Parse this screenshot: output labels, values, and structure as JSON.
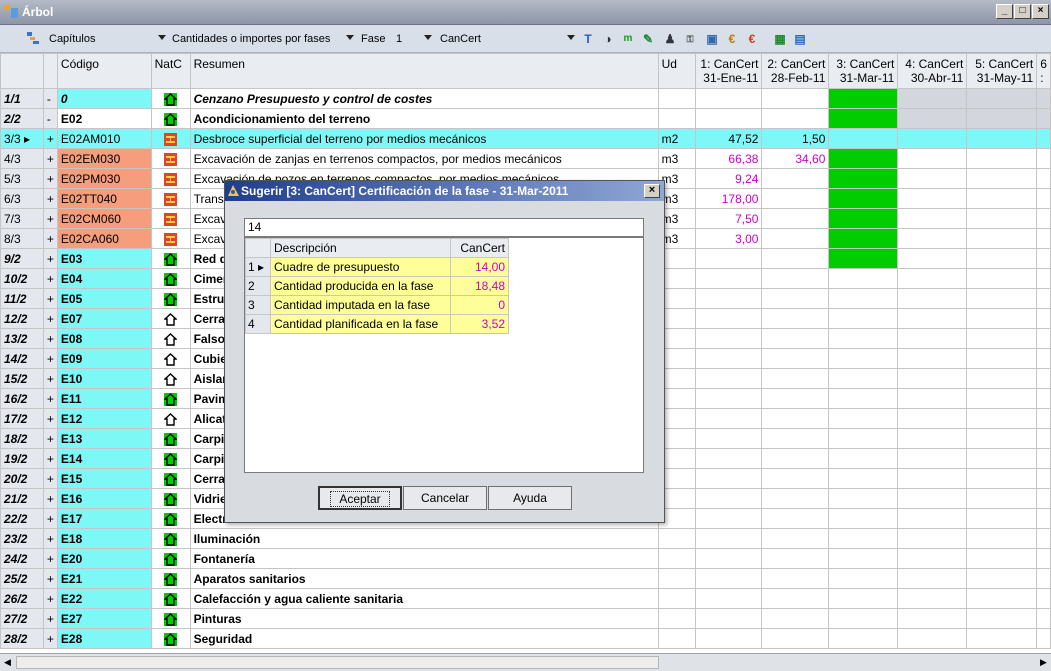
{
  "window": {
    "title": "Árbol",
    "minimize": "_",
    "maximize": "□",
    "close": "×"
  },
  "toolbar": {
    "level_select": "Capítulos",
    "mode_select": "Cantidades o importes por fases",
    "fase_label": "Fase",
    "fase_value": "1",
    "column_select": "CanCert",
    "icons": [
      "text-icon",
      "contrast-icon",
      "measure-icon",
      "edit-icon",
      "people-icon",
      "key-icon",
      "calendar-icon",
      "euro-icon",
      "euro-fill-icon",
      "table-icon",
      "columns-icon"
    ]
  },
  "grid": {
    "headers": {
      "codigo": "Código",
      "natc": "NatC",
      "resumen": "Resumen",
      "ud": "Ud",
      "c1": [
        "1: CanCert",
        "31-Ene-11"
      ],
      "c2": [
        "2: CanCert",
        "28-Feb-11"
      ],
      "c3": [
        "3: CanCert",
        "31-Mar-11"
      ],
      "c4": [
        "4: CanCert",
        "30-Abr-11"
      ],
      "c5": [
        "5: CanCert",
        "31-May-11"
      ],
      "c6": [
        "6",
        ":"
      ]
    },
    "rows": [
      {
        "idx": "1/1",
        "exp": "-",
        "code": "0",
        "nat": "chapter",
        "res": "Cenzano Presupuesto y control de costes",
        "ud": "",
        "v1": "",
        "v2": "",
        "codeStyle": "cyan",
        "resStyle": "bold-italic",
        "idxStyle": "italic"
      },
      {
        "idx": "2/2",
        "exp": "-",
        "code": "E02",
        "nat": "chapter",
        "res": "Acondicionamiento del terreno",
        "ud": "",
        "v1": "",
        "v2": "",
        "codeStyle": "plain",
        "resStyle": "bold",
        "idxStyle": "italic"
      },
      {
        "idx": "3/3 ▸",
        "exp": "+",
        "code": "E02AM010",
        "nat": "item",
        "res": "Desbroce superficial del terreno por medios mecánicos",
        "ud": "m2",
        "v1": "47,52",
        "v2": "1,50",
        "codeStyle": "cyan",
        "resStyle": "plain",
        "idxStyle": "plain",
        "v1mag": false,
        "v2mag": false,
        "selected": true
      },
      {
        "idx": "4/3",
        "exp": "+",
        "code": "E02EM030",
        "nat": "item",
        "res": "Excavación de zanjas en terrenos compactos, por medios mecánicos",
        "ud": "m3",
        "v1": "66,38",
        "v2": "34,60",
        "codeStyle": "salmon",
        "resStyle": "plain",
        "idxStyle": "plain",
        "v1mag": true,
        "v2mag": true
      },
      {
        "idx": "5/3",
        "exp": "+",
        "code": "E02PM030",
        "nat": "item",
        "res": "Excavación de pozos en terrenos compactos, por medios mecánicos",
        "ud": "m3",
        "v1": "9,24",
        "v2": "",
        "codeStyle": "salmon",
        "resStyle": "plain",
        "idxStyle": "plain",
        "v1mag": true
      },
      {
        "idx": "6/3",
        "exp": "+",
        "code": "E02TT040",
        "nat": "item",
        "res": "Transporte de tierras",
        "ud": "m3",
        "v1": "178,00",
        "v2": "",
        "codeStyle": "salmon",
        "resStyle": "plain",
        "idxStyle": "plain",
        "v1mag": true
      },
      {
        "idx": "7/3",
        "exp": "+",
        "code": "E02CM060",
        "nat": "item",
        "res": "Excavación",
        "ud": "m3",
        "v1": "7,50",
        "v2": "",
        "codeStyle": "salmon",
        "resStyle": "plain",
        "idxStyle": "plain",
        "v1mag": true
      },
      {
        "idx": "8/3",
        "exp": "+",
        "code": "E02CA060",
        "nat": "item",
        "res": "Excavación",
        "ud": "m3",
        "v1": "3,00",
        "v2": "",
        "codeStyle": "salmon",
        "resStyle": "plain",
        "idxStyle": "plain",
        "v1mag": true
      },
      {
        "idx": "9/2",
        "exp": "+",
        "code": "E03",
        "nat": "chapter",
        "res": "Red de saneamiento",
        "ud": "",
        "v1": "",
        "v2": "",
        "codeStyle": "cyan",
        "resStyle": "bold",
        "idxStyle": "italic"
      },
      {
        "idx": "10/2",
        "exp": "+",
        "code": "E04",
        "nat": "chapter",
        "res": "Cimentaciones",
        "ud": "",
        "v1": "",
        "v2": "",
        "codeStyle": "cyan",
        "resStyle": "bold",
        "idxStyle": "italic"
      },
      {
        "idx": "11/2",
        "exp": "+",
        "code": "E05",
        "nat": "chapter",
        "res": "Estructuras",
        "ud": "",
        "v1": "",
        "v2": "",
        "codeStyle": "cyan",
        "resStyle": "bold",
        "idxStyle": "italic"
      },
      {
        "idx": "12/2",
        "exp": "+",
        "code": "E07",
        "nat": "chapter-white",
        "res": "Cerramientos",
        "ud": "",
        "v1": "",
        "v2": "",
        "codeStyle": "cyan",
        "resStyle": "bold",
        "idxStyle": "italic"
      },
      {
        "idx": "13/2",
        "exp": "+",
        "code": "E08",
        "nat": "chapter-white",
        "res": "Falsos techos",
        "ud": "",
        "v1": "",
        "v2": "",
        "codeStyle": "cyan",
        "resStyle": "bold",
        "idxStyle": "italic"
      },
      {
        "idx": "14/2",
        "exp": "+",
        "code": "E09",
        "nat": "chapter-white",
        "res": "Cubiertas",
        "ud": "",
        "v1": "",
        "v2": "",
        "codeStyle": "cyan",
        "resStyle": "bold",
        "idxStyle": "italic"
      },
      {
        "idx": "15/2",
        "exp": "+",
        "code": "E10",
        "nat": "chapter-white",
        "res": "Aislamientos",
        "ud": "",
        "v1": "",
        "v2": "",
        "codeStyle": "cyan",
        "resStyle": "bold",
        "idxStyle": "italic"
      },
      {
        "idx": "16/2",
        "exp": "+",
        "code": "E11",
        "nat": "chapter",
        "res": "Pavimentos",
        "ud": "",
        "v1": "",
        "v2": "",
        "codeStyle": "cyan",
        "resStyle": "bold",
        "idxStyle": "italic"
      },
      {
        "idx": "17/2",
        "exp": "+",
        "code": "E12",
        "nat": "chapter-white",
        "res": "Alicatados",
        "ud": "",
        "v1": "",
        "v2": "",
        "codeStyle": "cyan",
        "resStyle": "bold",
        "idxStyle": "italic"
      },
      {
        "idx": "18/2",
        "exp": "+",
        "code": "E13",
        "nat": "chapter",
        "res": "Carpintería exterior",
        "ud": "",
        "v1": "",
        "v2": "",
        "codeStyle": "cyan",
        "resStyle": "bold",
        "idxStyle": "italic"
      },
      {
        "idx": "19/2",
        "exp": "+",
        "code": "E14",
        "nat": "chapter",
        "res": "Carpintería interior",
        "ud": "",
        "v1": "",
        "v2": "",
        "codeStyle": "cyan",
        "resStyle": "bold",
        "idxStyle": "italic"
      },
      {
        "idx": "20/2",
        "exp": "+",
        "code": "E15",
        "nat": "chapter",
        "res": "Cerrajería",
        "ud": "",
        "v1": "",
        "v2": "",
        "codeStyle": "cyan",
        "resStyle": "bold",
        "idxStyle": "italic"
      },
      {
        "idx": "21/2",
        "exp": "+",
        "code": "E16",
        "nat": "chapter",
        "res": "Vidriería",
        "ud": "",
        "v1": "",
        "v2": "",
        "codeStyle": "cyan",
        "resStyle": "bold",
        "idxStyle": "italic"
      },
      {
        "idx": "22/2",
        "exp": "+",
        "code": "E17",
        "nat": "chapter",
        "res": "Electricidad",
        "ud": "",
        "v1": "",
        "v2": "",
        "codeStyle": "cyan",
        "resStyle": "bold",
        "idxStyle": "italic"
      },
      {
        "idx": "23/2",
        "exp": "+",
        "code": "E18",
        "nat": "chapter",
        "res": "Iluminación",
        "ud": "",
        "v1": "",
        "v2": "",
        "codeStyle": "cyan",
        "resStyle": "bold",
        "idxStyle": "italic"
      },
      {
        "idx": "24/2",
        "exp": "+",
        "code": "E20",
        "nat": "chapter",
        "res": "Fontanería",
        "ud": "",
        "v1": "",
        "v2": "",
        "codeStyle": "cyan",
        "resStyle": "bold",
        "idxStyle": "italic"
      },
      {
        "idx": "25/2",
        "exp": "+",
        "code": "E21",
        "nat": "chapter",
        "res": "Aparatos sanitarios",
        "ud": "",
        "v1": "",
        "v2": "",
        "codeStyle": "cyan",
        "resStyle": "bold",
        "idxStyle": "italic"
      },
      {
        "idx": "26/2",
        "exp": "+",
        "code": "E22",
        "nat": "chapter",
        "res": "Calefacción y agua caliente sanitaria",
        "ud": "",
        "v1": "",
        "v2": "",
        "codeStyle": "cyan",
        "resStyle": "bold",
        "idxStyle": "italic"
      },
      {
        "idx": "27/2",
        "exp": "+",
        "code": "E27",
        "nat": "chapter",
        "res": "Pinturas",
        "ud": "",
        "v1": "",
        "v2": "",
        "codeStyle": "cyan",
        "resStyle": "bold",
        "idxStyle": "italic"
      },
      {
        "idx": "28/2",
        "exp": "+",
        "code": "E28",
        "nat": "chapter",
        "res": "Seguridad",
        "ud": "",
        "v1": "",
        "v2": "",
        "codeStyle": "cyan",
        "resStyle": "bold",
        "idxStyle": "italic"
      }
    ]
  },
  "dialog": {
    "title": "Sugerir [3: CanCert] Certificación de la fase - 31-Mar-2011",
    "input_value": "14",
    "col_desc": "Descripción",
    "col_val": "CanCert",
    "rows": [
      {
        "idx": "1 ▸",
        "desc": "Cuadre de presupuesto",
        "val": "14,00"
      },
      {
        "idx": "2",
        "desc": "Cantidad producida en la fase",
        "val": "18,48"
      },
      {
        "idx": "3",
        "desc": "Cantidad imputada en la fase",
        "val": "0"
      },
      {
        "idx": "4",
        "desc": "Cantidad planificada en la fase",
        "val": "3,52"
      }
    ],
    "accept": "Aceptar",
    "cancel": "Cancelar",
    "help": "Ayuda"
  },
  "colors": {
    "green": "#00cc00",
    "cyan": "#7ef7f7",
    "salmon": "#f59d7c",
    "magenta": "#cc00cc",
    "yellow": "#ffff9a"
  }
}
